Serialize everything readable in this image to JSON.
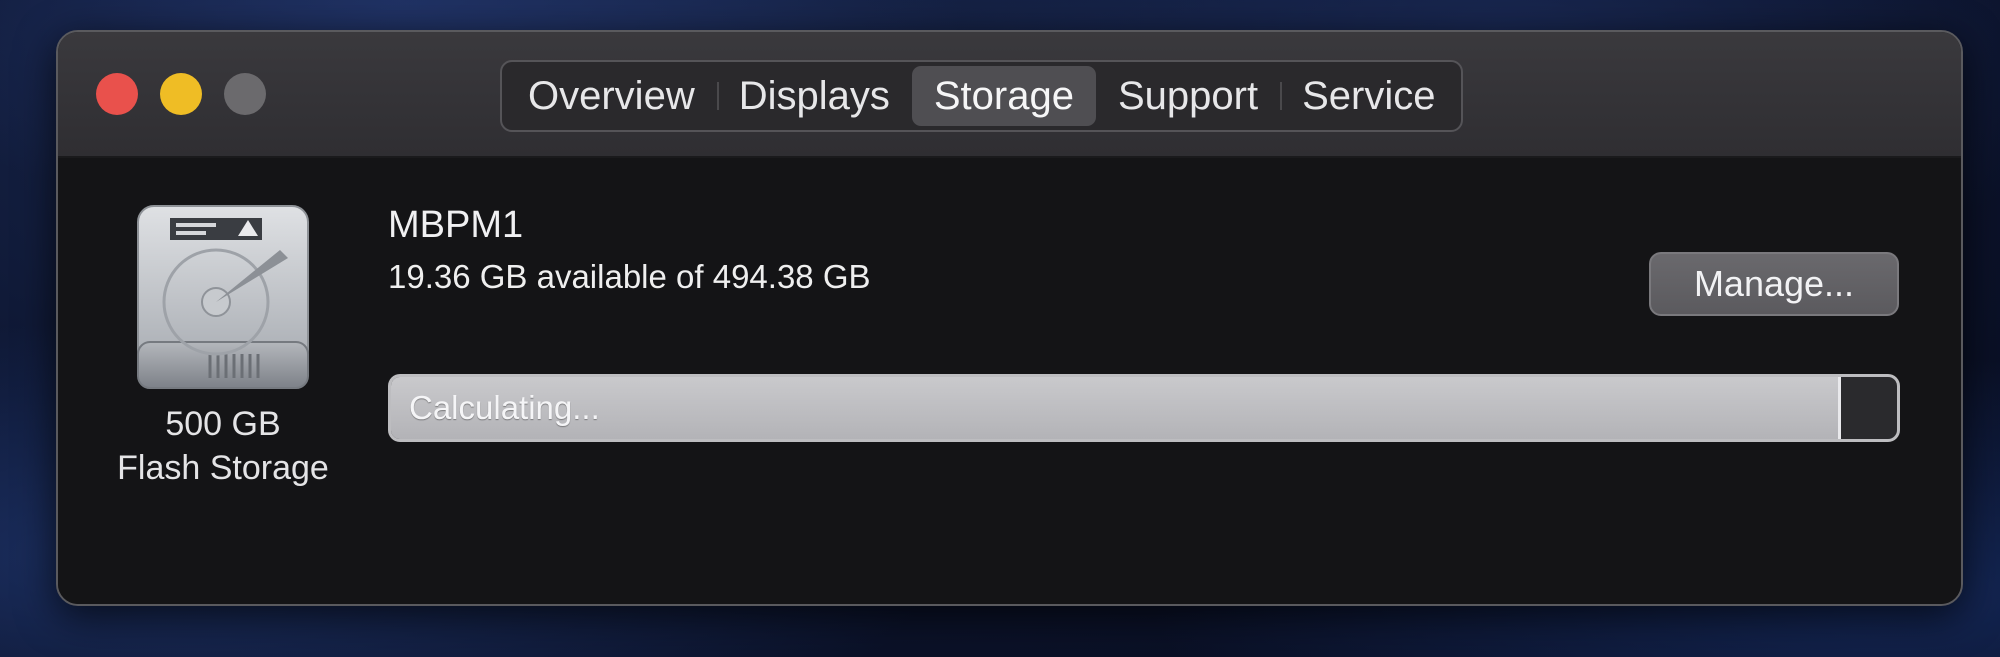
{
  "window": {
    "tabs": [
      {
        "label": "Overview",
        "active": false
      },
      {
        "label": "Displays",
        "active": false
      },
      {
        "label": "Storage",
        "active": true
      },
      {
        "label": "Support",
        "active": false
      },
      {
        "label": "Service",
        "active": false
      }
    ]
  },
  "disk": {
    "icon": "hard-drive-icon",
    "capacity": "500 GB",
    "type": "Flash Storage"
  },
  "volume": {
    "name": "MBPM1",
    "availability": "19.36 GB available of 494.38 GB",
    "manage_label": "Manage...",
    "bar_label": "Calculating...",
    "used_fraction": 0.961
  },
  "colors": {
    "close": "#e9514c",
    "minimize": "#efbd25",
    "zoom_inactive": "#6b6a6d"
  }
}
